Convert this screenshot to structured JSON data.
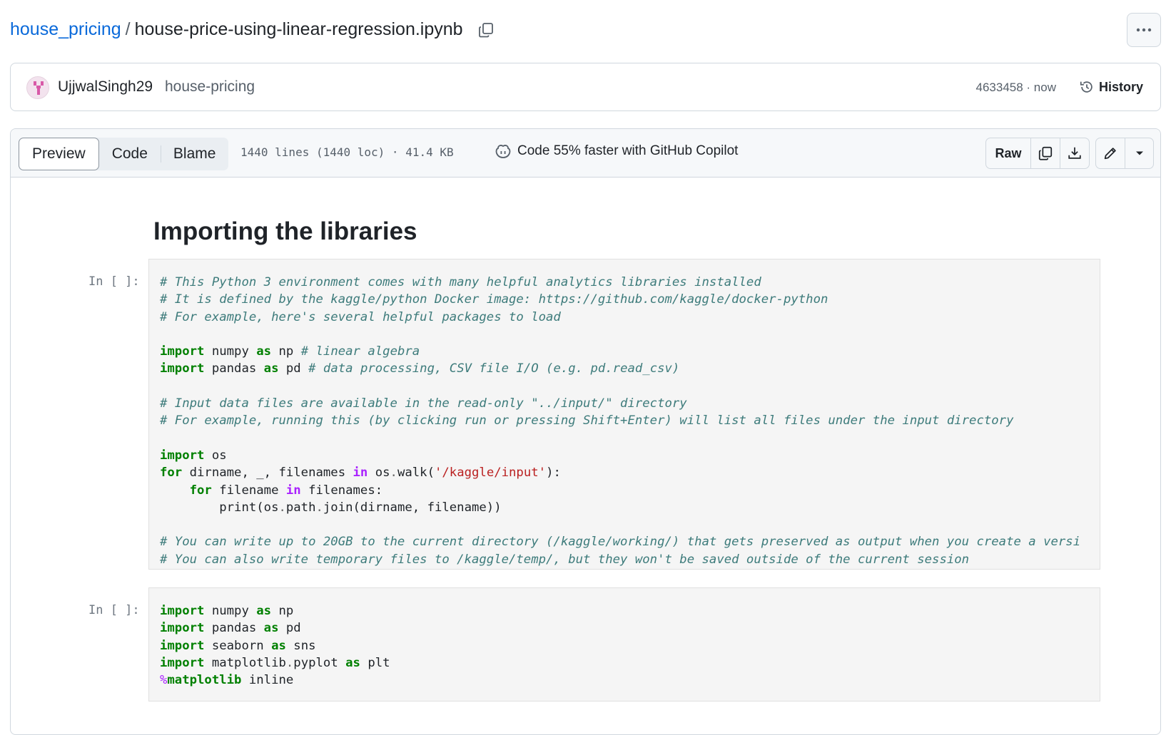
{
  "breadcrumb": {
    "repo": "house_pricing",
    "separator": "/",
    "file": "house-price-using-linear-regression.ipynb"
  },
  "commit": {
    "author": "UjjwalSingh29",
    "message": "house-pricing",
    "meta": "4633458 · now",
    "history_label": "History"
  },
  "file_header": {
    "tabs": [
      "Preview",
      "Code",
      "Blame"
    ],
    "lines_info": "1440 lines (1440 loc) · 41.4 KB",
    "copilot_text": "Code 55% faster with GitHub Copilot",
    "raw_label": "Raw"
  },
  "notebook": {
    "heading": "Importing the libraries",
    "cells": [
      {
        "prompt": "In [ ]:",
        "lines": [
          "# This Python 3 environment comes with many helpful analytics libraries installed",
          "# It is defined by the kaggle/python Docker image: https://github.com/kaggle/docker-python",
          "# For example, here's several helpful packages to load",
          "",
          "import numpy as np # linear algebra",
          "import pandas as pd # data processing, CSV file I/O (e.g. pd.read_csv)",
          "",
          "# Input data files are available in the read-only \"../input/\" directory",
          "# For example, running this (by clicking run or pressing Shift+Enter) will list all files under the input directory",
          "",
          "import os",
          "for dirname, _, filenames in os.walk('/kaggle/input'):",
          "    for filename in filenames:",
          "        print(os.path.join(dirname, filename))",
          "",
          "# You can write up to 20GB to the current directory (/kaggle/working/) that gets preserved as output when you create a versi",
          "# You can also write temporary files to /kaggle/temp/, but they won't be saved outside of the current session"
        ]
      },
      {
        "prompt": "In [ ]:",
        "lines": [
          "import numpy as np",
          "import pandas as pd",
          "import seaborn as sns",
          "import matplotlib.pyplot as plt",
          "%matplotlib inline"
        ]
      }
    ]
  },
  "icons": {
    "copy_path": "copy-icon",
    "kebab": "kebab-horizontal-icon",
    "history": "history-icon",
    "copilot": "copilot-icon",
    "copy_raw": "copy-icon",
    "download": "download-icon",
    "edit": "pencil-icon",
    "dropdown": "triangle-down-icon"
  },
  "colors": {
    "link": "#0969da",
    "border": "#d0d7de",
    "code_bg": "#f5f5f5",
    "comment": "#3d7b7b",
    "keyword": "#008000",
    "string": "#ba2121",
    "operator_word": "#aa22ff"
  }
}
